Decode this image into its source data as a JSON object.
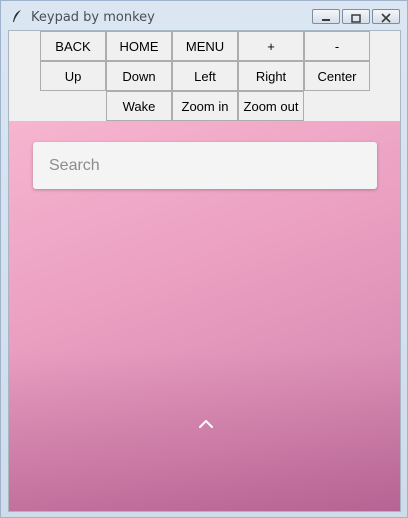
{
  "window": {
    "title": "Keypad by monkey",
    "controls": [
      "minimize-icon",
      "maximize-icon",
      "close-icon"
    ]
  },
  "keypad": {
    "row1": [
      "BACK",
      "HOME",
      "MENU",
      "+",
      "-"
    ],
    "row2": [
      "Up",
      "Down",
      "Left",
      "Right",
      "Center"
    ],
    "row3": [
      "Wake",
      "Zoom in",
      "Zoom out"
    ]
  },
  "device": {
    "search_placeholder": "Search",
    "app_drawer_icon": "chevron-up-icon",
    "background_colors": [
      "#f6b5cf",
      "#c77aa4"
    ]
  }
}
